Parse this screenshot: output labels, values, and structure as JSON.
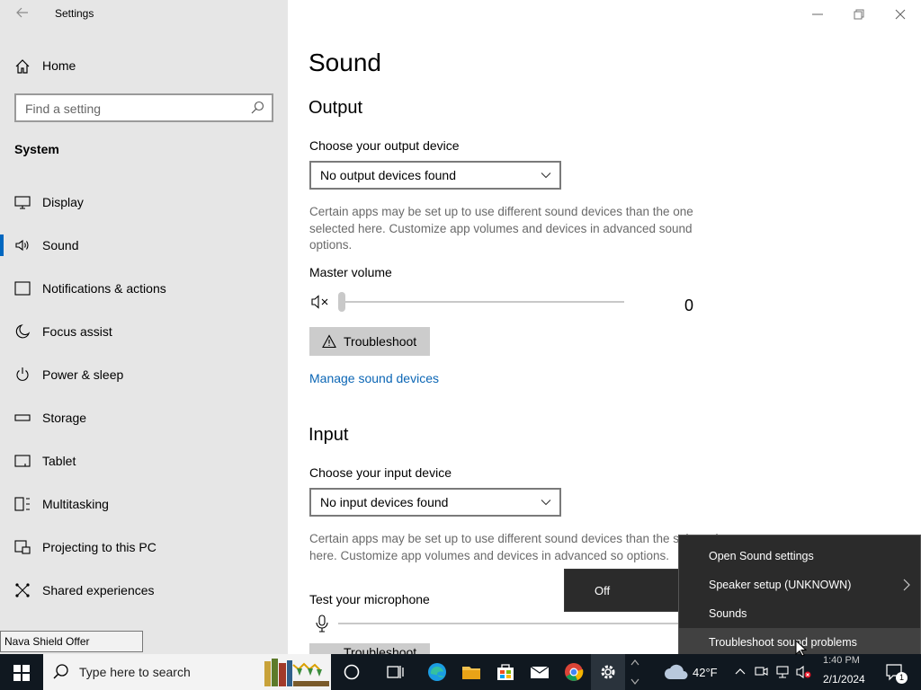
{
  "window": {
    "title": "Settings",
    "back_icon": "back-arrow-icon"
  },
  "sidebar": {
    "home_label": "Home",
    "search_placeholder": "Find a setting",
    "section_title": "System",
    "items": [
      {
        "label": "Display",
        "icon": "display-icon"
      },
      {
        "label": "Sound",
        "icon": "speaker-icon",
        "selected": true
      },
      {
        "label": "Notifications & actions",
        "icon": "notifications-icon"
      },
      {
        "label": "Focus assist",
        "icon": "moon-icon"
      },
      {
        "label": "Power & sleep",
        "icon": "power-icon"
      },
      {
        "label": "Storage",
        "icon": "storage-icon"
      },
      {
        "label": "Tablet",
        "icon": "tablet-icon"
      },
      {
        "label": "Multitasking",
        "icon": "multitasking-icon"
      },
      {
        "label": "Projecting to this PC",
        "icon": "projecting-icon"
      },
      {
        "label": "Shared experiences",
        "icon": "shared-experiences-icon"
      }
    ]
  },
  "tooltip": "Nava Shield Offer",
  "main": {
    "title": "Sound",
    "output": {
      "heading": "Output",
      "device_label": "Choose your output device",
      "device_value": "No output devices found",
      "description": "Certain apps may be set up to use different sound devices than the one selected here. Customize app volumes and devices in advanced sound options.",
      "master_volume_label": "Master volume",
      "volume_value": "0",
      "volume_level": 0,
      "troubleshoot_label": "Troubleshoot",
      "manage_link": "Manage sound devices"
    },
    "input": {
      "heading": "Input",
      "device_label": "Choose your input device",
      "device_value": "No input devices found",
      "description": "Certain apps may be set up to use different sound devices than the selected here. Customize app volumes and devices in advanced so options.",
      "test_mic_label": "Test your microphone",
      "troubleshoot_label": "Troubleshoot"
    }
  },
  "off_popup": {
    "label": "Off"
  },
  "context_menu": {
    "items": [
      {
        "label": "Open Sound settings"
      },
      {
        "label": "Speaker setup (UNKNOWN)",
        "submenu": true
      },
      {
        "label": "Sounds"
      },
      {
        "label": "Troubleshoot sound problems",
        "hover": true
      }
    ]
  },
  "taskbar": {
    "search_placeholder": "Type here to search",
    "weather": "42°F",
    "time": "1:40 PM",
    "date": "2/1/2024",
    "notification_count": "1",
    "apps": [
      "cortana-icon",
      "task-view-icon",
      "edge-icon",
      "file-explorer-icon",
      "store-icon",
      "mail-icon",
      "chrome-icon",
      "settings-gear-icon"
    ]
  },
  "colors": {
    "accent": "#0067c0",
    "link": "#0b66b5",
    "sidebar_bg": "#e6e6e6",
    "taskbar_bg": "#101820",
    "menu_bg": "#2b2b2b"
  }
}
